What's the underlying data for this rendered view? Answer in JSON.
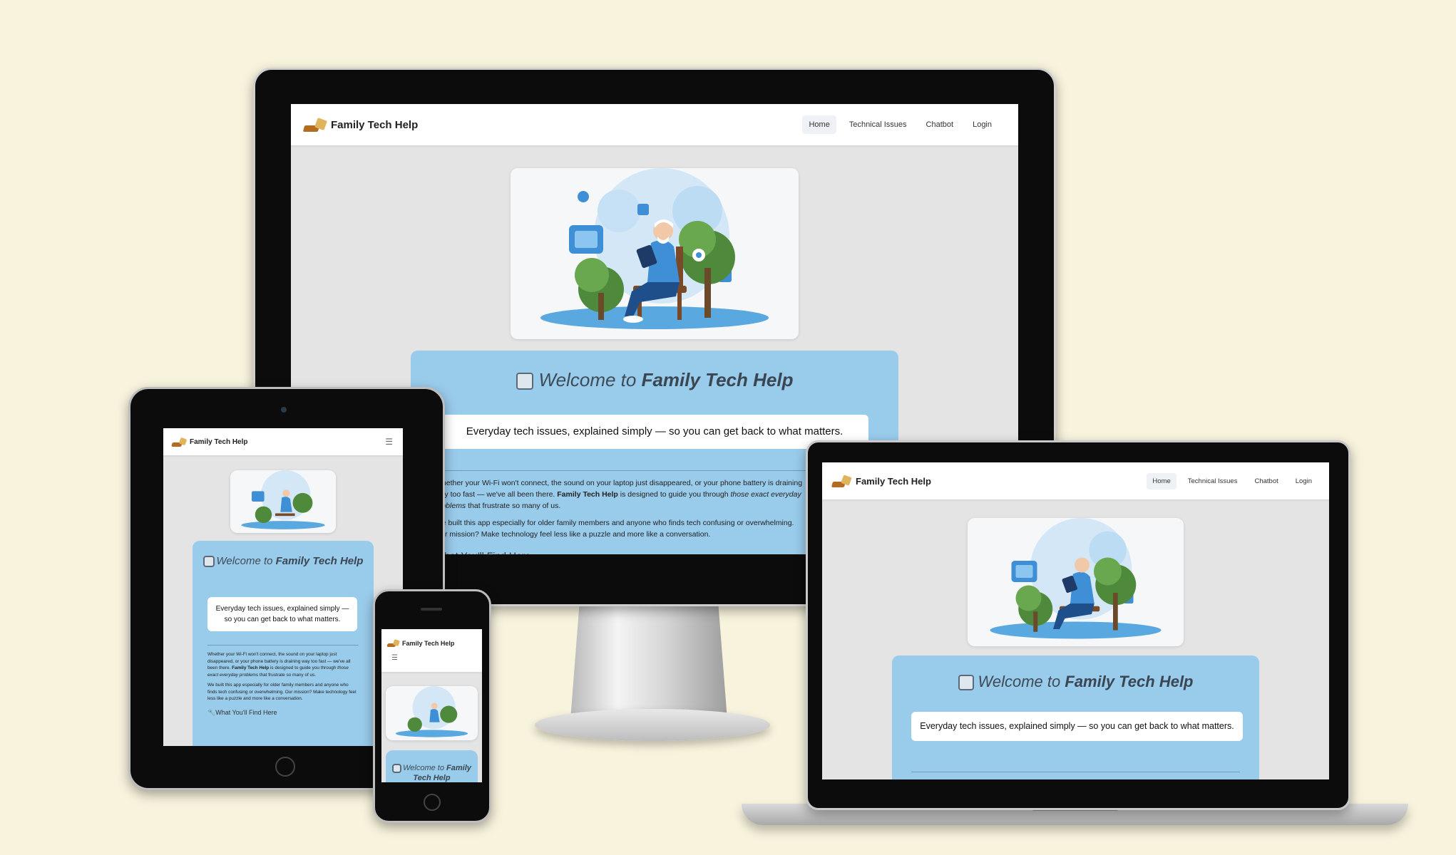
{
  "site": {
    "brand": "Family Tech Help",
    "nav_links": [
      "Home",
      "Technical Issues",
      "Chatbot",
      "Login"
    ],
    "active_link": "Home",
    "menu_icon": "hamburger-icon",
    "logo_icon": "tools-logo-icon"
  },
  "welcome": {
    "prefix": "Welcome to",
    "brand": "Family Tech Help",
    "icon": "family-icon",
    "tagline": "Everyday tech issues, explained simply — so you can get back to what matters."
  },
  "body": {
    "p1_a": "Whether your Wi-Fi won't connect, the sound on your laptop just disappeared, or your phone battery is draining way too fast — we've all been there.",
    "p1_brand": "Family Tech Help",
    "p1_b": "is designed to guide you through",
    "p1_em": "those exact everyday problems",
    "p1_c": "that frustrate so many of us.",
    "p2": "We built this app especially for older family members and anyone who finds tech confusing or overwhelming. Our mission? Make technology feel less like a puzzle and more like a conversation.",
    "section_title": "What You'll Find Here",
    "section_icon": "wrench-icon"
  },
  "colors": {
    "background": "#f8f3dd",
    "welcome_card": "#99cbeb",
    "page_bg": "#e4e4e4"
  }
}
